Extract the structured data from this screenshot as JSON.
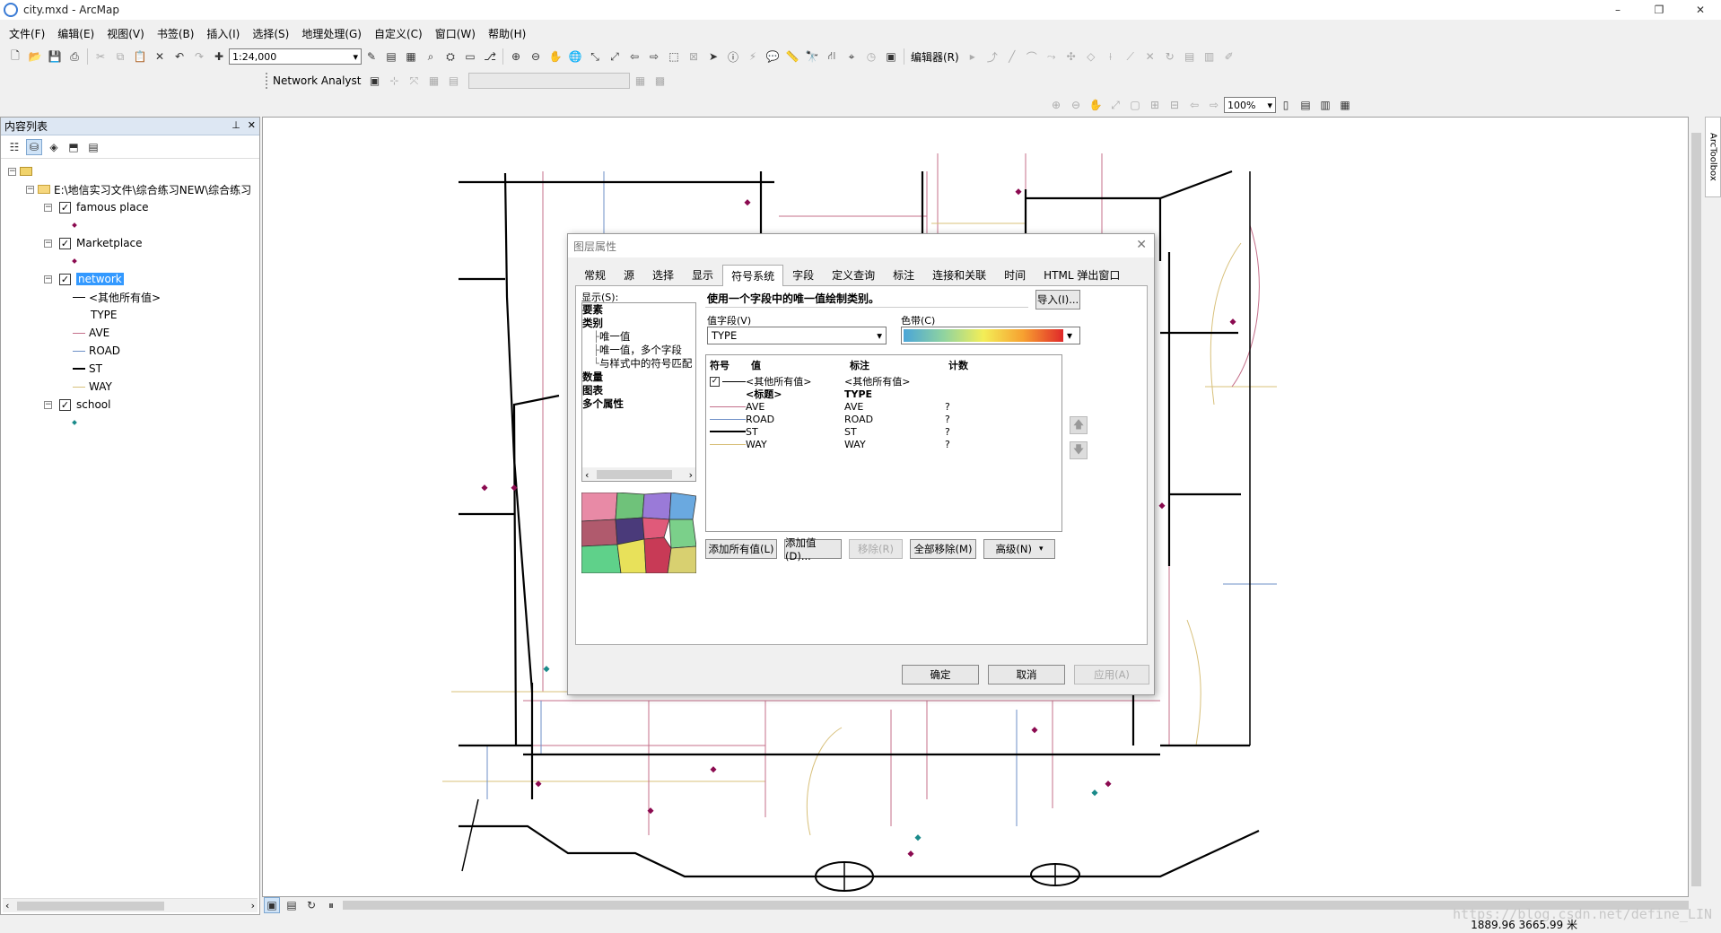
{
  "window": {
    "title": "city.mxd - ArcMap",
    "minimize": "–",
    "restore": "❐",
    "close": "✕"
  },
  "menu": [
    "文件(F)",
    "编辑(E)",
    "视图(V)",
    "书签(B)",
    "插入(I)",
    "选择(S)",
    "地理处理(G)",
    "自定义(C)",
    "窗口(W)",
    "帮助(H)"
  ],
  "toolbar": {
    "scale": "1:24,000",
    "editor_label": "编辑器(R)",
    "network_analyst": "Network Analyst",
    "zoom_level": "100%"
  },
  "toc": {
    "title": "内容列表",
    "pin": "⊥",
    "close": "✕",
    "root_path": "E:\\地信实习文件\\综合练习NEW\\综合练习",
    "layers": [
      {
        "name": "famous place"
      },
      {
        "name": "Marketplace"
      },
      {
        "name": "network",
        "legend": [
          {
            "label": "<其他所有值>"
          },
          {
            "label": "TYPE"
          },
          {
            "label": "AVE",
            "color": "#c46f8a"
          },
          {
            "label": "ROAD",
            "color": "#6d8fc7"
          },
          {
            "label": "ST",
            "color": "#000000"
          },
          {
            "label": "WAY",
            "color": "#d8c07a"
          }
        ]
      },
      {
        "name": "school"
      }
    ]
  },
  "dialog": {
    "title": "图层属性",
    "tabs": [
      "常规",
      "源",
      "选择",
      "显示",
      "符号系统",
      "字段",
      "定义查询",
      "标注",
      "连接和关联",
      "时间",
      "HTML 弹出窗口"
    ],
    "active_tab": "符号系统",
    "show_label": "显示(S):",
    "show_items": {
      "features": "要素",
      "categories": "类别",
      "unique": "唯一值",
      "unique_many": "唯一值，多个字段",
      "match_style": "与样式中的符号匹配",
      "quantities": "数量",
      "charts": "图表",
      "multiple": "多个属性"
    },
    "description": "使用一个字段中的唯一值绘制类别。",
    "import_button": "导入(I)...",
    "value_field_label": "值字段(V)",
    "value_field": "TYPE",
    "color_ramp_label": "色带(C)",
    "table": {
      "headers": {
        "symbol": "符号",
        "value": "值",
        "label": "标注",
        "count": "计数"
      },
      "other_row": {
        "value": "<其他所有值>",
        "label": "<其他所有值>"
      },
      "heading_row": {
        "value": "<标题>",
        "label": "TYPE"
      },
      "rows": [
        {
          "value": "AVE",
          "label": "AVE",
          "count": "?",
          "color": "#c46f8a",
          "width": 1
        },
        {
          "value": "ROAD",
          "label": "ROAD",
          "count": "?",
          "color": "#6d8fc7",
          "width": 1
        },
        {
          "value": "ST",
          "label": "ST",
          "count": "?",
          "color": "#000000",
          "width": 2
        },
        {
          "value": "WAY",
          "label": "WAY",
          "count": "?",
          "color": "#d8c07a",
          "width": 1
        }
      ]
    },
    "buttons": {
      "add_all": "添加所有值(L)",
      "add_values": "添加值(D)...",
      "remove": "移除(R)",
      "remove_all": "全部移除(M)",
      "advanced": "高级(N)",
      "ok": "确定",
      "cancel": "取消",
      "apply": "应用(A)"
    }
  },
  "right_panel": "ArcToolbox",
  "status": {
    "coords": "1889.96  3665.99 米"
  },
  "watermark": "https://blog.csdn.net/define_LIN"
}
